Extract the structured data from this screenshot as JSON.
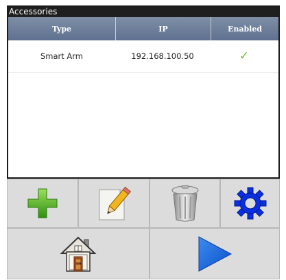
{
  "panel": {
    "title": "Accessories"
  },
  "table": {
    "headers": [
      "Type",
      "IP",
      "Enabled"
    ],
    "rows": [
      {
        "type": "Smart Arm",
        "ip": "192.168.100.50",
        "enabled": "✓"
      }
    ]
  },
  "toolbar": {
    "icons": [
      "add-icon",
      "edit-pencil-icon",
      "trash-icon",
      "settings-gear-icon",
      "home-icon",
      "play-arrow-icon"
    ]
  },
  "colors": {
    "header_bg": "#6b7c98",
    "check": "#6fbf2a",
    "add_green": "#4caf1e",
    "gear_blue": "#0a2fe0",
    "play_blue": "#1d6fe0"
  }
}
